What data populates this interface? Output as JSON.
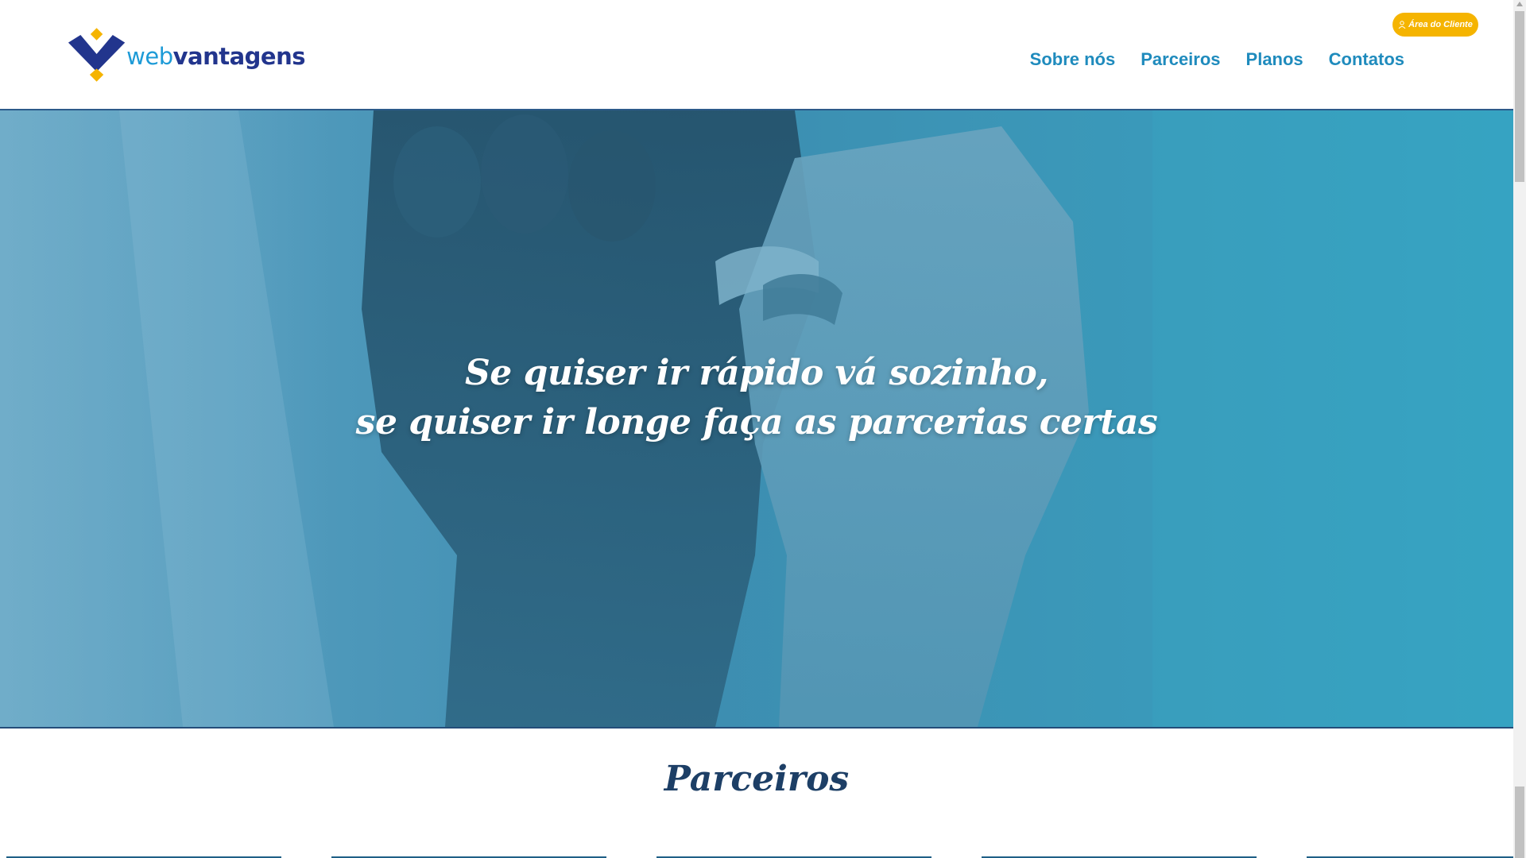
{
  "header": {
    "logo_part1": "web",
    "logo_part2": "vantagens",
    "client_button": "Área do Cliente",
    "nav": [
      "Sobre nós",
      "Parceiros",
      "Planos",
      "Contatos"
    ]
  },
  "hero": {
    "line1": "Se quiser ir rápido vá sozinho,",
    "line2": "se quiser ir longe faça as parcerias certas"
  },
  "section": {
    "title": "Parceiros"
  },
  "colors": {
    "brand_blue": "#22358d",
    "brand_light_blue": "#1e9bd7",
    "accent_yellow": "#f5b400",
    "nav_color": "#1f8bbd",
    "hero_tint": "#3d8db0",
    "title_color": "#1d3f66"
  },
  "icons": [
    "logo-diamond-icon",
    "user-icon"
  ]
}
